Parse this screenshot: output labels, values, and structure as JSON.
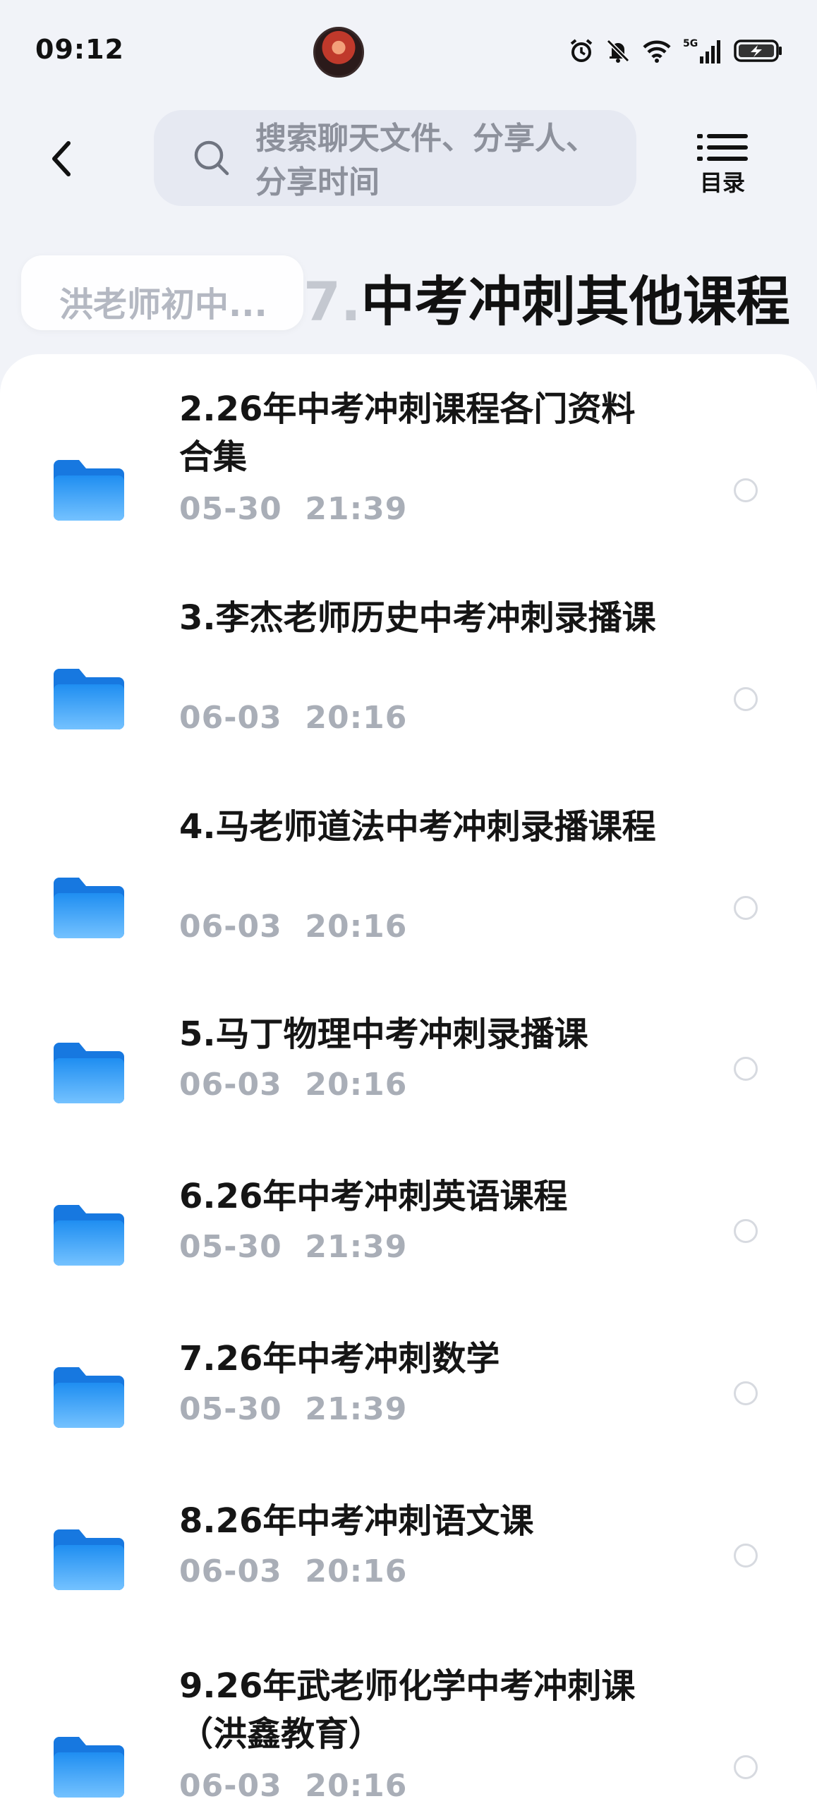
{
  "status_bar": {
    "time": "09:12",
    "icons": [
      "alarm-icon",
      "mute-icon",
      "wifi-icon",
      "signal-5g-icon",
      "battery-charging-icon"
    ],
    "network_label": "5G"
  },
  "header": {
    "search": {
      "placeholder": "搜索聊天文件、分享人、分享时间",
      "placeholder_line1": "搜索聊天文件、分享人、",
      "placeholder_line2": "分享时间"
    },
    "toc_label": "目录"
  },
  "breadcrumb": {
    "parent": "洪老师初中...",
    "current_prefix": "7.",
    "current": "中考冲刺其他课程"
  },
  "files": [
    {
      "name": "2.26年中考冲刺课程各门资料合集",
      "date": "05-30  21:39",
      "selected": false
    },
    {
      "name": "3.李杰老师历史中考冲刺录播课",
      "date": "06-03  20:16",
      "selected": false
    },
    {
      "name": "4.马老师道法中考冲刺录播课程",
      "date": "06-03  20:16",
      "selected": false
    },
    {
      "name": "5.马丁物理中考冲刺录播课",
      "date": "06-03  20:16",
      "selected": false
    },
    {
      "name": "6.26年中考冲刺英语课程",
      "date": "05-30  21:39",
      "selected": false
    },
    {
      "name": "7.26年中考冲刺数学",
      "date": "05-30  21:39",
      "selected": false
    },
    {
      "name": "8.26年中考冲刺语文课",
      "date": "06-03  20:16",
      "selected": false
    },
    {
      "name": "9.26年武老师化学中考冲刺课（洪鑫教育）",
      "date": "06-03  20:16",
      "selected": false
    }
  ],
  "colors": {
    "background": "#f1f3f8",
    "folder_top": "#1f8ef1",
    "folder_bottom": "#74c2ff",
    "date_text": "#a9aeb7",
    "search_bg": "#e6e9f2"
  }
}
